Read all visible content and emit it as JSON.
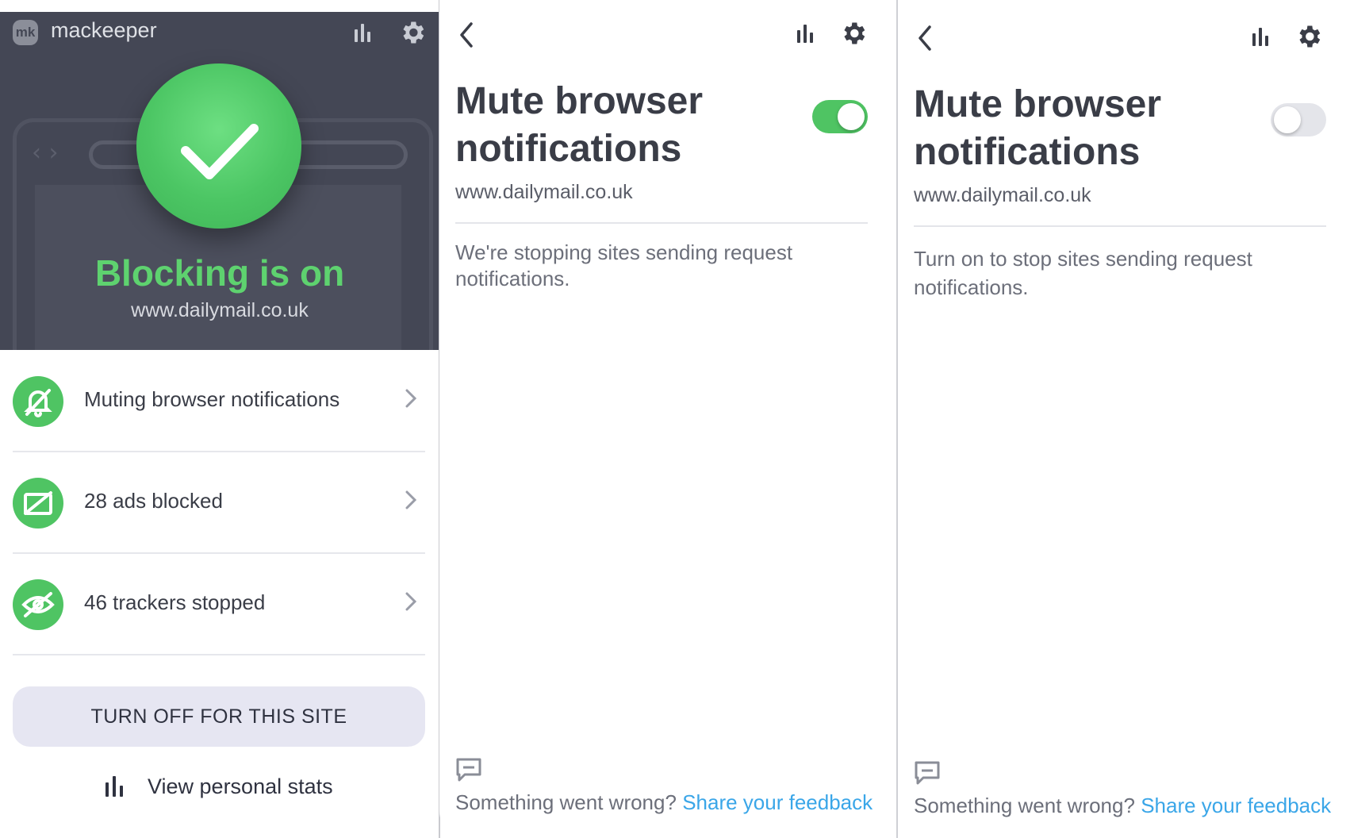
{
  "colors": {
    "accent_green": "#4fc463",
    "toggle_off": "#e4e5ea",
    "link_blue": "#3aa6e8",
    "hero_bg": "#444755"
  },
  "main": {
    "brand": "mackeeper",
    "logo_text": "mk",
    "status_title": "Blocking is on",
    "site": "www.dailymail.co.uk",
    "items": [
      {
        "label": "Muting browser notifications",
        "icon": "muted-bell-icon"
      },
      {
        "label": "28 ads blocked",
        "icon": "ad-blocked-icon"
      },
      {
        "label": "46 trackers stopped",
        "icon": "eye-off-icon"
      }
    ],
    "turn_off_label": "TURN OFF FOR THIS SITE",
    "stats_label": "View personal stats"
  },
  "detail_on": {
    "title_line1": "Mute browser",
    "title_line2": "notifications",
    "toggle_on": true,
    "site": "www.dailymail.co.uk",
    "description": "We're stopping sites sending request notifications.",
    "feedback_prefix": "Something went wrong?",
    "feedback_link": "Share your feedback"
  },
  "detail_off": {
    "title_line1": "Mute browser",
    "title_line2": "notifications",
    "toggle_on": false,
    "site": "www.dailymail.co.uk",
    "description": "Turn on to stop sites sending request notifications.",
    "feedback_prefix": "Something went wrong?",
    "feedback_link": "Share your feedback"
  }
}
